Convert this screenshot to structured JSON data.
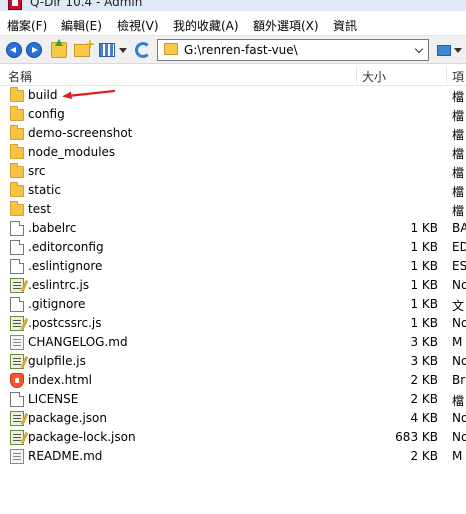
{
  "window": {
    "title": "Q-Dir 10.4 - Admin"
  },
  "menu": [
    {
      "label": "檔案(F)"
    },
    {
      "label": "編輯(E)"
    },
    {
      "label": "檢視(V)"
    },
    {
      "label": "我的收藏(A)"
    },
    {
      "label": "額外選項(X)"
    },
    {
      "label": "資訊"
    }
  ],
  "toolbar": {
    "icons": [
      "back-icon",
      "forward-icon",
      "up-folder-icon",
      "new-folder-icon",
      "view-mode-icon",
      "refresh-icon",
      "monitor-icon"
    ]
  },
  "address": {
    "path": "G:\\renren-fast-vue\\"
  },
  "columns": {
    "name": "名稱",
    "size": "大小",
    "type": "項"
  },
  "files": [
    {
      "name": "build",
      "size": "",
      "type": "檔",
      "icon": "folder-icon"
    },
    {
      "name": "config",
      "size": "",
      "type": "檔",
      "icon": "folder-icon"
    },
    {
      "name": "demo-screenshot",
      "size": "",
      "type": "檔",
      "icon": "folder-icon"
    },
    {
      "name": "node_modules",
      "size": "",
      "type": "檔",
      "icon": "folder-icon"
    },
    {
      "name": "src",
      "size": "",
      "type": "檔",
      "icon": "folder-icon"
    },
    {
      "name": "static",
      "size": "",
      "type": "檔",
      "icon": "folder-icon"
    },
    {
      "name": "test",
      "size": "",
      "type": "檔",
      "icon": "folder-icon"
    },
    {
      "name": ".babelrc",
      "size": "1 KB",
      "type": "BA",
      "icon": "file-icon"
    },
    {
      "name": ".editorconfig",
      "size": "1 KB",
      "type": "ED",
      "icon": "file-icon"
    },
    {
      "name": ".eslintignore",
      "size": "1 KB",
      "type": "ES",
      "icon": "file-icon"
    },
    {
      "name": ".eslintrc.js",
      "size": "1 KB",
      "type": "No",
      "icon": "notepad-icon"
    },
    {
      "name": ".gitignore",
      "size": "1 KB",
      "type": "文",
      "icon": "file-icon"
    },
    {
      "name": ".postcssrc.js",
      "size": "1 KB",
      "type": "No",
      "icon": "notepad-icon"
    },
    {
      "name": "CHANGELOG.md",
      "size": "3 KB",
      "type": "M",
      "icon": "document-icon"
    },
    {
      "name": "gulpfile.js",
      "size": "3 KB",
      "type": "No",
      "icon": "notepad-icon"
    },
    {
      "name": "index.html",
      "size": "2 KB",
      "type": "Bra",
      "icon": "brave-icon"
    },
    {
      "name": "LICENSE",
      "size": "2 KB",
      "type": "檔",
      "icon": "file-icon"
    },
    {
      "name": "package.json",
      "size": "4 KB",
      "type": "No",
      "icon": "notepad-icon"
    },
    {
      "name": "package-lock.json",
      "size": "683 KB",
      "type": "No",
      "icon": "notepad-icon"
    },
    {
      "name": "README.md",
      "size": "2 KB",
      "type": "M",
      "icon": "document-icon"
    }
  ],
  "annotation": {
    "target": "build",
    "color": "#e02020"
  }
}
